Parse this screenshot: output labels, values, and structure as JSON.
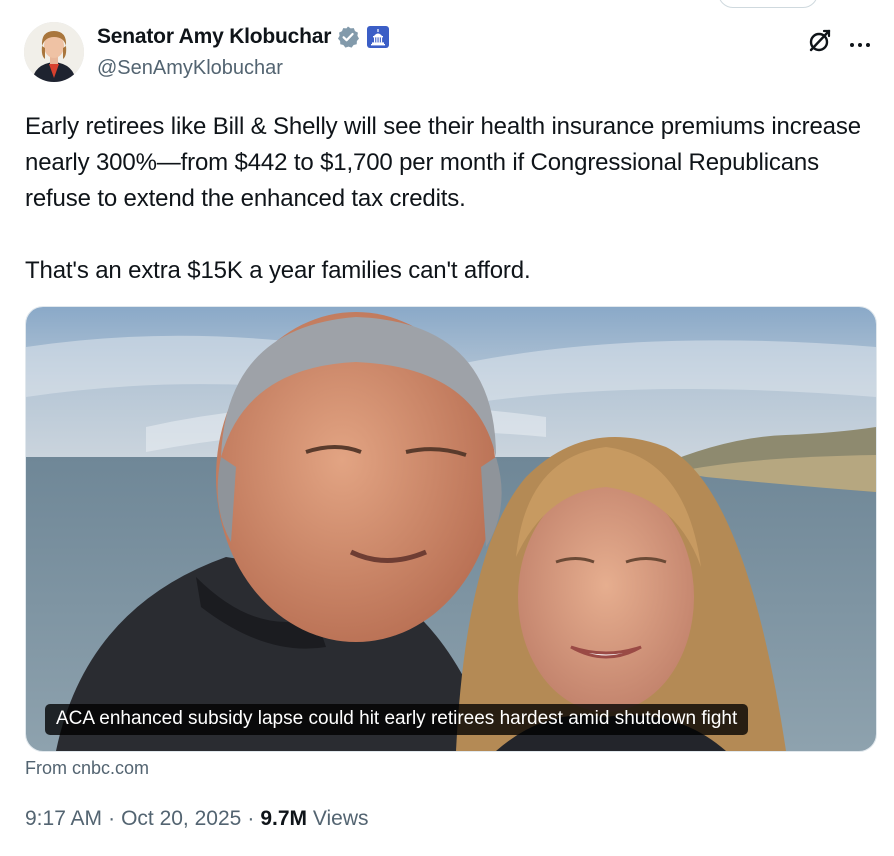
{
  "author": {
    "display_name": "Senator Amy Klobuchar",
    "handle": "@SenAmyKlobuchar",
    "verified_icon": "verified-badge-icon",
    "affiliation_icon": "government-badge-icon"
  },
  "header_actions": {
    "grok_icon": "grok-icon",
    "more_icon": "more-options-icon"
  },
  "tweet": {
    "text_paragraph_1": "Early retirees like Bill & Shelly will see their health insurance premiums increase nearly 300%—from $442 to $1,700 per month if Congressional Republicans refuse to extend the enhanced tax credits.",
    "text_paragraph_2": "That's an extra $15K a year families can't afford."
  },
  "card": {
    "headline": "ACA enhanced subsidy lapse could hit early retirees hardest amid shutdown fight",
    "source": "From cnbc.com"
  },
  "meta": {
    "time": "9:17 AM",
    "separator": "·",
    "date": "Oct 20, 2025",
    "views_count": "9.7M",
    "views_label": "Views"
  },
  "colors": {
    "text_primary": "#0f1419",
    "text_secondary": "#536471",
    "verified_blue": "#1d9bf0",
    "gov_badge_blue": "#3b5ec6"
  }
}
